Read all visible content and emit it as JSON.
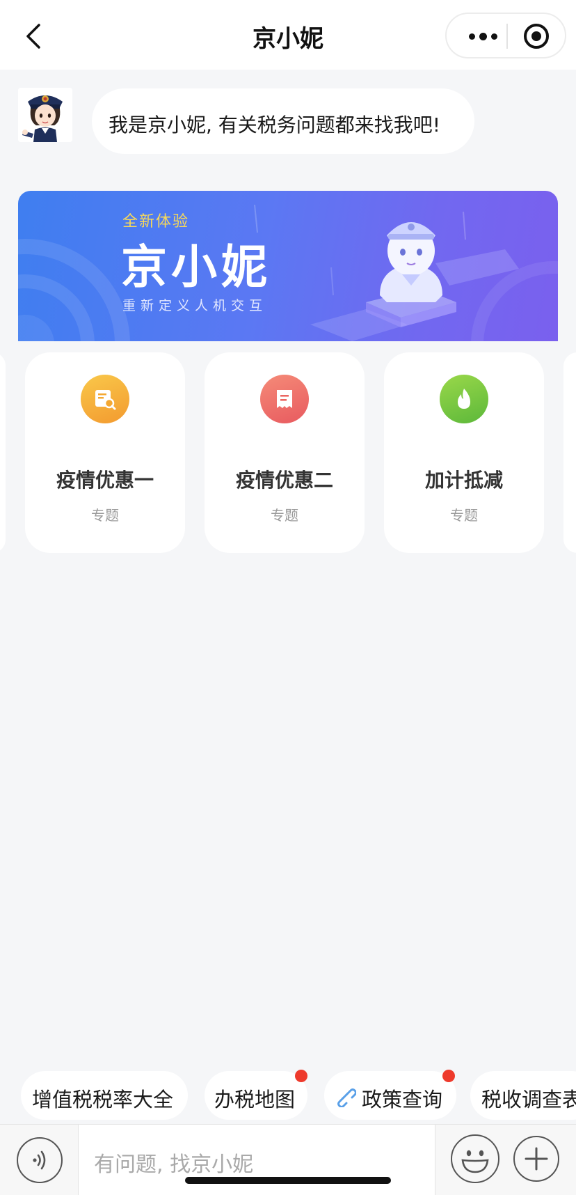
{
  "nav": {
    "title": "京小妮"
  },
  "chat": {
    "greeting": "我是京小妮, 有关税务问题都来找我吧!"
  },
  "banner": {
    "subtitle": "全新体验",
    "title": "京小妮",
    "tagline": "重新定义人机交互"
  },
  "cards": [
    {
      "title": "疫情优惠一",
      "subtitle": "专题",
      "icon": "document-search-icon",
      "color": "#f6a93a"
    },
    {
      "title": "疫情优惠二",
      "subtitle": "专题",
      "icon": "receipt-icon",
      "color": "#ee6d66"
    },
    {
      "title": "加计抵减",
      "subtitle": "专题",
      "icon": "flame-icon",
      "color": "#7cc73f"
    }
  ],
  "quick_actions": [
    {
      "label": "增值税税率大全",
      "has_badge": false
    },
    {
      "label": "办税地图",
      "has_badge": true
    },
    {
      "label": "政策查询",
      "has_badge": true,
      "icon": "link-icon"
    },
    {
      "label": "税收调查表",
      "has_badge": false
    }
  ],
  "input": {
    "placeholder": "有问题, 找京小妮"
  },
  "colors": {
    "banner_start": "#3f7ef0",
    "banner_end": "#7a60ee",
    "badge": "#ee3a2c",
    "accent_yellow": "#f7d95a"
  }
}
